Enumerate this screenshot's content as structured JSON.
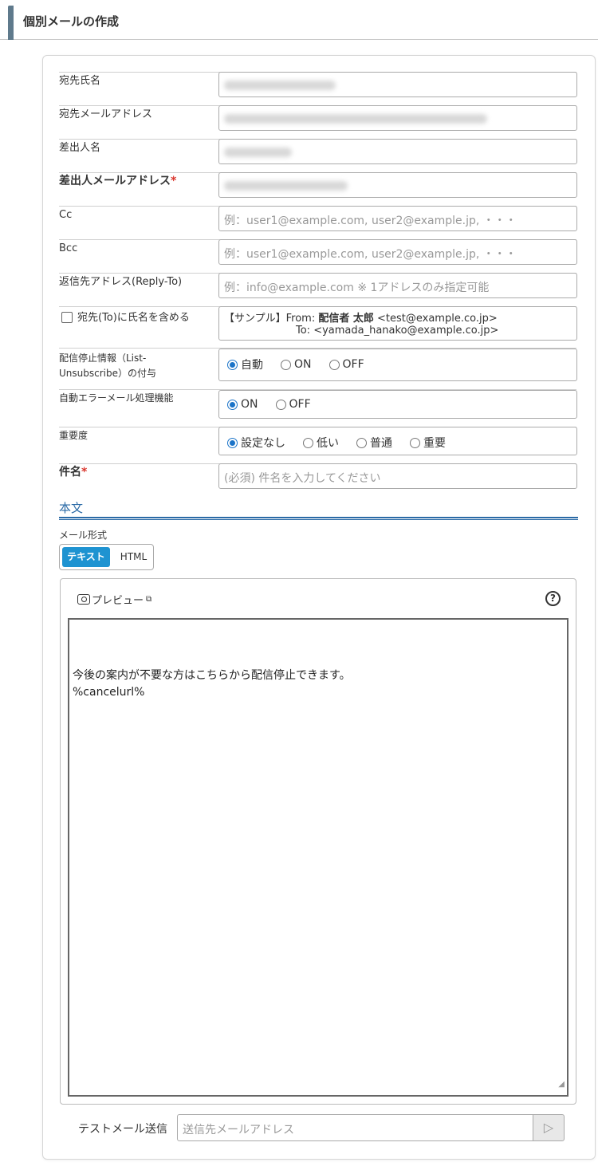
{
  "header": {
    "title": "個別メールの作成"
  },
  "form": {
    "to_name": {
      "label": "宛先氏名"
    },
    "to_email": {
      "label": "宛先メールアドレス"
    },
    "from_name": {
      "label": "差出人名"
    },
    "from_email": {
      "label": "差出人メールアドレス",
      "required": "*"
    },
    "cc": {
      "label": "Cc",
      "placeholder": "例：user1@example.com, user2@example.jp, ・・・"
    },
    "bcc": {
      "label": "Bcc",
      "placeholder": "例：user1@example.com, user2@example.jp, ・・・"
    },
    "reply_to": {
      "label": "返信先アドレス(Reply-To)",
      "placeholder": "例：info@example.com ※ 1アドレスのみ指定可能"
    },
    "include_name": {
      "label": "宛先(To)に氏名を含める",
      "sample_prefix": "【サンプル】From: ",
      "sample_from_name": "配信者 太郎",
      "sample_from_addr": " <test@example.co.jp>",
      "sample_to": "To: <yamada_hanako@example.co.jp>"
    },
    "list_unsubscribe": {
      "label_line1": "配信停止情報（List-",
      "label_line2": "Unsubscribe）の付与",
      "options": [
        "自動",
        "ON",
        "OFF"
      ],
      "selected": "自動"
    },
    "auto_error": {
      "label": "自動エラーメール処理機能",
      "options": [
        "ON",
        "OFF"
      ],
      "selected": "ON"
    },
    "importance": {
      "label": "重要度",
      "options": [
        "設定なし",
        "低い",
        "普通",
        "重要"
      ],
      "selected": "設定なし"
    },
    "subject": {
      "label": "件名",
      "required": "*",
      "placeholder": "(必須) 件名を入力してください"
    }
  },
  "body_section": {
    "title": "本文",
    "format_label": "メール形式",
    "format_options": [
      "テキスト",
      "HTML"
    ],
    "format_selected": "テキスト",
    "preview_label": "プレビュー",
    "help_icon": "?",
    "body_line1": "今後の案内が不要な方はこちらから配信停止できます。",
    "body_line2": "%cancelurl%"
  },
  "test_mail": {
    "label": "テストメール送信",
    "placeholder": "送信先メールアドレス"
  },
  "colors": {
    "accent": "#1e93d1",
    "section": "#2a6aa6",
    "required": "#d9342b"
  }
}
